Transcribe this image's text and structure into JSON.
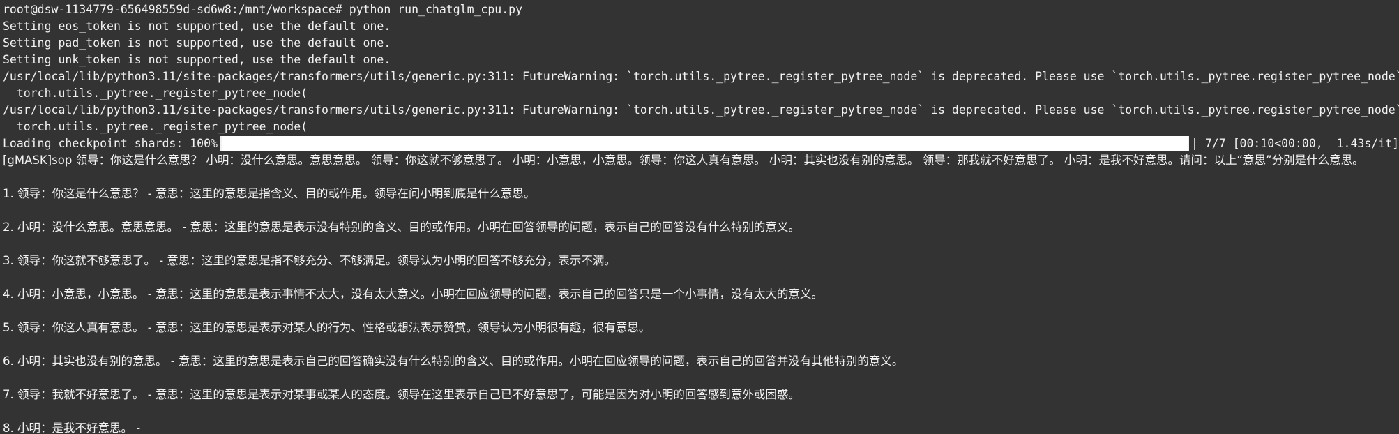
{
  "terminal": {
    "prompt_line": "root@dsw-1134779-656498559d-sd6w8:/mnt/workspace# python run_chatglm_cpu.py",
    "warnings": [
      "Setting eos_token is not supported, use the default one.",
      "Setting pad_token is not supported, use the default one.",
      "Setting unk_token is not supported, use the default one.",
      "/usr/local/lib/python3.11/site-packages/transformers/utils/generic.py:311: FutureWarning: `torch.utils._pytree._register_pytree_node` is deprecated. Please use `torch.utils._pytree.register_pytree_node` instead.",
      "  torch.utils._pytree._register_pytree_node(",
      "/usr/local/lib/python3.11/site-packages/transformers/utils/generic.py:311: FutureWarning: `torch.utils._pytree._register_pytree_node` is deprecated. Please use `torch.utils._pytree.register_pytree_node` instead.",
      "  torch.utils._pytree._register_pytree_node("
    ],
    "progress": {
      "label": "Loading checkpoint shards: 100%",
      "fraction": 1.0,
      "stats": "| 7/7 [00:10<00:00,  1.43s/it]"
    },
    "response_intro": "[gMASK]sop 领导：你这是什么意思？ 小明：没什么意思。意思意思。 领导：你这就不够意思了。 小明：小意思，小意思。领导：你这人真有意思。 小明：其实也没有别的意思。 领导：那我就不好意思了。 小明：是我不好意思。请问：以上“意思”分别是什么意思。",
    "answers": [
      "1. 领导：你这是什么意思？ - 意思：这里的意思是指含义、目的或作用。领导在问小明到底是什么意思。",
      "2. 小明：没什么意思。意思意思。 - 意思：这里的意思是表示没有特别的含义、目的或作用。小明在回答领导的问题，表示自己的回答没有什么特别的意义。",
      "3. 领导：你这就不够意思了。 - 意思：这里的意思是指不够充分、不够满足。领导认为小明的回答不够充分，表示不满。",
      "4. 小明：小意思，小意思。 - 意思：这里的意思是表示事情不太大，没有太大意义。小明在回应领导的问题，表示自己的回答只是一个小事情，没有太大的意义。",
      "5. 领导：你这人真有意思。 - 意思：这里的意思是表示对某人的行为、性格或想法表示赞赏。领导认为小明很有趣，很有意思。",
      "6. 小明：其实也没有别的意思。 - 意思：这里的意思是表示自己的回答确实没有什么特别的含义、目的或作用。小明在回应领导的问题，表示自己的回答并没有其他特别的意义。",
      "7. 领导：我就不好意思了。 - 意思：这里的意思是表示对某事或某人的态度。领导在这里表示自己已不好意思了，可能是因为对小明的回答感到意外或困惑。",
      "8. 小明：是我不好意思。 -"
    ]
  }
}
